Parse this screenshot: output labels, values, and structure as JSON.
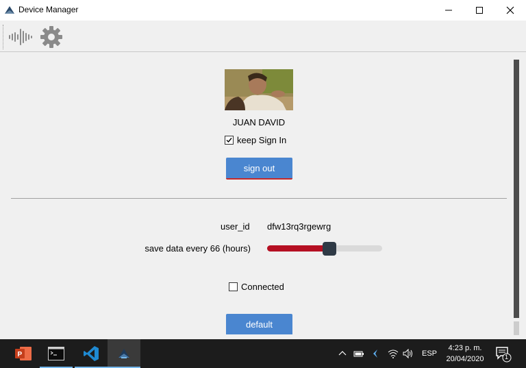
{
  "window": {
    "title": "Device Manager",
    "minimize_icon": "minimize-icon",
    "maximize_icon": "maximize-icon",
    "close_icon": "close-icon"
  },
  "toolbar": {
    "items": [
      "waveform-icon",
      "gear-icon"
    ]
  },
  "profile": {
    "name": "JUAN DAVID",
    "keep_sign_in_label": "keep Sign In",
    "keep_sign_in_checked": true,
    "sign_out_label": "sign out"
  },
  "settings": {
    "user_id_label": "user_id",
    "user_id_value": "dfw13rq3rgewrg",
    "save_label": "save data every 66 (hours)",
    "save_slider_fraction": 0.54,
    "connected_label": "Connected",
    "connected_checked": false,
    "default_label": "default"
  },
  "colors": {
    "accent_button": "#4a86d0",
    "slider_fill": "#b50f22",
    "slider_thumb": "#2f3a46"
  },
  "taskbar": {
    "apps": [
      "powerpoint-icon",
      "terminal-icon",
      "vscode-icon",
      "device-manager-icon"
    ],
    "language": "ESP",
    "time": "4:23 p. m.",
    "date": "20/04/2020",
    "notification_count": "1"
  }
}
